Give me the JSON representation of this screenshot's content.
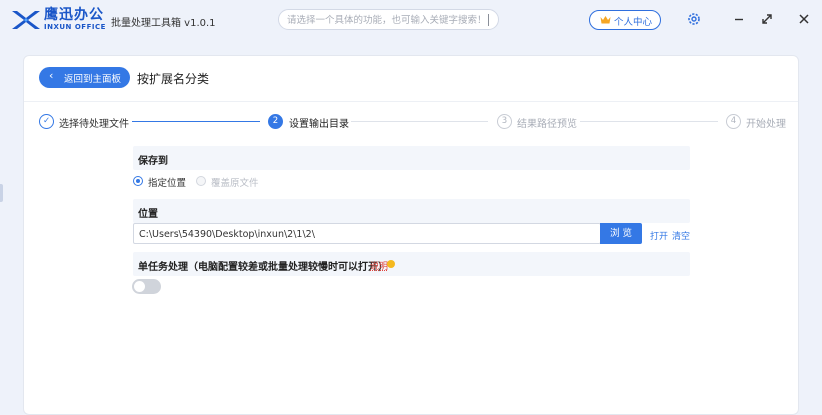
{
  "app": {
    "brand_cn": "鹰迅办公",
    "brand_en": "INXUN OFFICE",
    "title": "批量处理工具箱 v1.0.1"
  },
  "search": {
    "placeholder": "请选择一个具体的功能，也可输入关键字搜索！"
  },
  "titlebar": {
    "user_center": "个人中心",
    "icons": [
      "crown-icon",
      "gear-icon",
      "minimize-icon",
      "maximize-icon",
      "close-icon"
    ]
  },
  "header": {
    "back_label": "返回到主面板",
    "page_title": "按扩展名分类"
  },
  "steps": [
    {
      "number": "✓",
      "label": "选择待处理文件",
      "state": "done"
    },
    {
      "number": "2",
      "label": "设置输出目录",
      "state": "active"
    },
    {
      "number": "3",
      "label": "结果路径预览",
      "state": "pending"
    },
    {
      "number": "4",
      "label": "开始处理",
      "state": "pending"
    }
  ],
  "save_to": {
    "title": "保存到",
    "options": [
      {
        "label": "指定位置",
        "selected": true
      },
      {
        "label": "覆盖原文件",
        "selected": false
      }
    ]
  },
  "location": {
    "title": "位置",
    "path": "C:\\Users\\54390\\Desktop\\inxun\\2\\1\\2\\",
    "browse": "浏 览",
    "open": "打开",
    "clear": "清空"
  },
  "single_task": {
    "title": "单任务处理（电脑配置较差或批量处理较慢时可以打开）",
    "help": "说明",
    "enabled": false
  },
  "colors": {
    "accent": "#3478e5",
    "background": "#eef2fa",
    "section_bg": "#f3f6fb",
    "warning": "#e0423a"
  }
}
